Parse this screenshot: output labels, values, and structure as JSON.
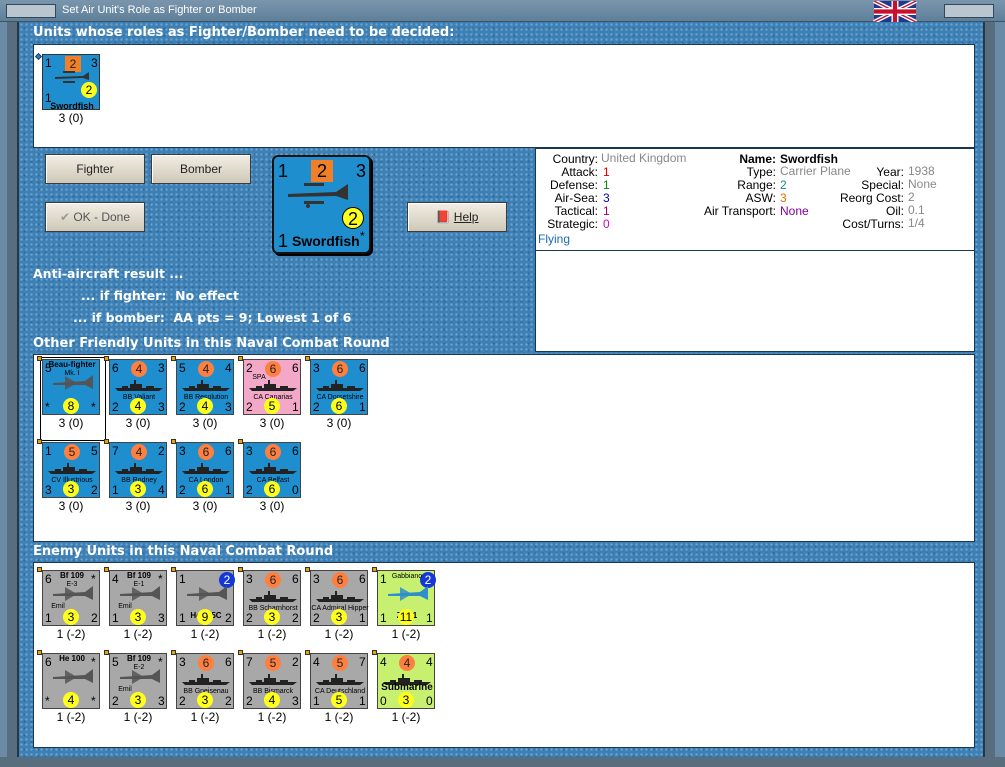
{
  "window": {
    "title": "Set Air Unit's Role as Fighter or Bomber"
  },
  "colors": {
    "blue_unit": "#1f8ecf",
    "grey_unit": "#a8a8a8",
    "pink_unit": "#f4a8c8",
    "green_unit": "#c8f070"
  },
  "headings": {
    "undecided": "Units whose roles as Fighter/Bomber need to be decided:",
    "friendly": "Other Friendly Units in this Naval Combat Round",
    "enemy": "Enemy Units in this Naval Combat Round"
  },
  "undecided_unit": {
    "tl": "1",
    "to": "2",
    "tr": "3",
    "bl": "1",
    "by": "2",
    "name": "Swordfish",
    "count": "3 (0)"
  },
  "buttons": {
    "fighter": "Fighter",
    "bomber": "Bomber",
    "ok": "OK - Done",
    "help": "Help"
  },
  "big_unit": {
    "tl": "1",
    "to": "2",
    "tr": "3",
    "bl": "1",
    "by": "2",
    "name": "Swordfish",
    "star": "*"
  },
  "antiair": {
    "title": "Anti-aircraft result ...",
    "fighter_label": "... if fighter:",
    "fighter_value": "No effect",
    "bomber_label": "... if bomber:",
    "bomber_value": "AA pts = 9; Lowest 1 of 6"
  },
  "info": {
    "country_label": "Country:",
    "country": "United Kingdom",
    "attack_label": "Attack:",
    "attack": "1",
    "defense_label": "Defense:",
    "defense": "1",
    "airsea_label": "Air-Sea:",
    "airsea": "3",
    "tactical_label": "Tactical:",
    "tactical": "1",
    "strategic_label": "Strategic:",
    "strategic": "0",
    "flying": "Flying",
    "name_label": "Name:",
    "name": "Swordfish",
    "type_label": "Type:",
    "type": "Carrier Plane",
    "year_label": "Year:",
    "year": "1938",
    "range_label": "Range:",
    "range": "2",
    "special_label": "Special:",
    "special": "None",
    "asw_label": "ASW:",
    "asw": "3",
    "reorg_label": "Reorg Cost:",
    "reorg": "2",
    "airtrans_label": "Air Transport:",
    "airtrans": "None",
    "oil_label": "Oil:",
    "oil": "0.1",
    "cost_label": "Cost/Turns:",
    "cost": "1/4"
  },
  "friendly_units": [
    {
      "name": "Beau-fighter",
      "sub": "Mk. I",
      "tl": "5",
      "to": "",
      "tr": "",
      "bl": "*",
      "by": "8",
      "br": "*",
      "count": "3 (0)",
      "color": "blue",
      "kind": "air",
      "selected": true
    },
    {
      "name": "BB Valiant",
      "tl": "6",
      "to": "4",
      "tr": "3",
      "bl": "2",
      "by": "4",
      "br": "3",
      "count": "3 (0)",
      "color": "blue",
      "kind": "ship"
    },
    {
      "name": "BB Resolution",
      "tl": "5",
      "to": "4",
      "tr": "4",
      "bl": "2",
      "by": "4",
      "br": "3",
      "count": "3 (0)",
      "color": "blue",
      "kind": "ship"
    },
    {
      "name": "CA Canarias",
      "sub": "SPA",
      "tl": "2",
      "to": "6",
      "tr": "6",
      "bl": "2",
      "by": "5",
      "br": "1",
      "count": "3 (0)",
      "color": "pink",
      "kind": "ship"
    },
    {
      "name": "CA Dorsetshire",
      "tl": "3",
      "to": "6",
      "tr": "6",
      "bl": "2",
      "by": "6",
      "br": "1",
      "count": "3 (0)",
      "color": "blue",
      "kind": "ship"
    },
    {
      "name": "CV Illustrious",
      "tl": "1",
      "to": "5",
      "tr": "5",
      "bl": "3",
      "by": "3",
      "br": "2",
      "count": "3 (0)",
      "color": "blue",
      "kind": "ship"
    },
    {
      "name": "BB Rodney",
      "tl": "7",
      "to": "4",
      "tr": "2",
      "bl": "1",
      "by": "3",
      "br": "4",
      "count": "3 (0)",
      "color": "blue",
      "kind": "ship"
    },
    {
      "name": "CA London",
      "tl": "3",
      "to": "6",
      "tr": "6",
      "bl": "2",
      "by": "6",
      "br": "1",
      "count": "3 (0)",
      "color": "blue",
      "kind": "ship"
    },
    {
      "name": "CA Belfast",
      "tl": "3",
      "to": "6",
      "tr": "6",
      "bl": "2",
      "by": "6",
      "br": "0",
      "count": "3 (0)",
      "color": "blue",
      "kind": "ship"
    }
  ],
  "enemy_units": [
    {
      "name": "Bf 109",
      "sub": "E-3",
      "pilot": "Emil",
      "tl": "6",
      "to": "",
      "tr": "*",
      "bl": "1",
      "by": "3",
      "br": "2",
      "count": "1 (-2)",
      "color": "grey",
      "kind": "air"
    },
    {
      "name": "Bf 109",
      "sub": "E-1",
      "pilot": "Emil",
      "tl": "4",
      "to": "",
      "tr": "*",
      "bl": "1",
      "by": "3",
      "br": "3",
      "count": "1 (-2)",
      "color": "grey",
      "kind": "air"
    },
    {
      "name": "He 115C",
      "tl": "1",
      "to": "",
      "tr": "",
      "blue": "2",
      "bl": "1",
      "by": "9",
      "br": "2",
      "count": "1 (-2)",
      "color": "grey",
      "kind": "air"
    },
    {
      "name": "BB Scharnhorst",
      "tl": "3",
      "to": "6",
      "tr": "6",
      "bl": "2",
      "by": "3",
      "br": "2",
      "count": "1 (-2)",
      "color": "grey",
      "kind": "ship"
    },
    {
      "name": "CA Admiral Hipper",
      "tl": "3",
      "to": "6",
      "tr": "6",
      "bl": "2",
      "by": "3",
      "br": "1",
      "count": "1 (-2)",
      "color": "grey",
      "kind": "ship"
    },
    {
      "name": "Z.501",
      "sub": "Gabbiano",
      "tl": "1",
      "to": "",
      "tr": "",
      "blue": "2",
      "bl": "1",
      "by": "11",
      "br": "1",
      "count": "1 (-2)",
      "color": "green",
      "kind": "air"
    },
    {
      "name": "He 100",
      "tl": "6",
      "to": "",
      "tr": "*",
      "bl": "*",
      "by": "4",
      "br": "*",
      "count": "1 (-2)",
      "color": "grey",
      "kind": "air"
    },
    {
      "name": "Bf 109",
      "sub": "E-2",
      "pilot": "Emil",
      "tl": "5",
      "to": "",
      "tr": "*",
      "bl": "2",
      "by": "3",
      "br": "3",
      "count": "1 (-2)",
      "color": "grey",
      "kind": "air"
    },
    {
      "name": "BB Gneisenau",
      "tl": "3",
      "to": "6",
      "tr": "6",
      "bl": "2",
      "by": "3",
      "br": "2",
      "count": "1 (-2)",
      "color": "grey",
      "kind": "ship"
    },
    {
      "name": "BB Bismarck",
      "tl": "7",
      "to": "5",
      "tr": "2",
      "bl": "2",
      "by": "4",
      "br": "3",
      "count": "1 (-2)",
      "color": "grey",
      "kind": "ship"
    },
    {
      "name": "CA Deutschland",
      "tl": "4",
      "to": "5",
      "tr": "7",
      "bl": "1",
      "by": "5",
      "br": "1",
      "count": "1 (-2)",
      "color": "grey",
      "kind": "ship"
    },
    {
      "name": "Submarine",
      "tl": "4",
      "to": "4",
      "tr": "4",
      "bl": "0",
      "by": "3",
      "br": "0",
      "count": "1 (-2)",
      "color": "green",
      "kind": "sub"
    }
  ]
}
